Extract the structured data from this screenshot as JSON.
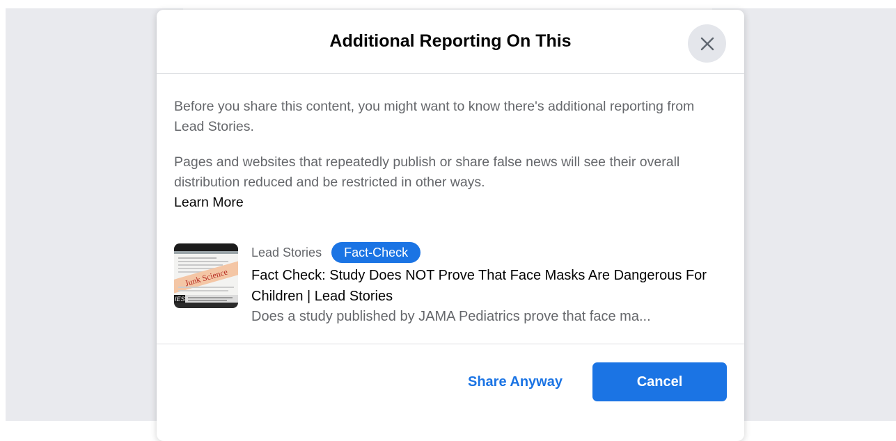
{
  "dialog": {
    "title": "Additional Reporting On This",
    "close_icon": "close-icon",
    "intro_text": "Before you share this content, you might want to know there's additional reporting from Lead Stories.",
    "policy_text": "Pages and websites that repeatedly publish or share false news will see their overall distribution reduced and be restricted in other ways.",
    "learn_more_label": "Learn More"
  },
  "article": {
    "publisher": "Lead Stories",
    "badge": "Fact-Check",
    "title": "Fact Check: Study Does NOT Prove That Face Masks Are Dangerous For Children | Lead Stories",
    "description": "Does a study published by JAMA Pediatrics prove that face ma...",
    "thumbnail_stamp": "Junk Science",
    "thumbnail_caption": "IES"
  },
  "footer": {
    "share_anyway_label": "Share Anyway",
    "cancel_label": "Cancel"
  },
  "colors": {
    "accent": "#1b74e4",
    "badge": "#1b74e4",
    "backdrop": "#e9eaee",
    "stamp": "#f4c6a5"
  }
}
